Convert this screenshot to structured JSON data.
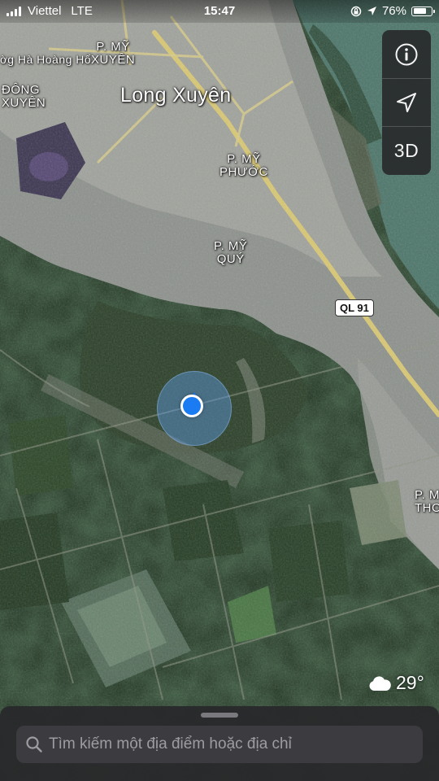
{
  "status_bar": {
    "carrier": "Viettel",
    "network": "LTE",
    "time": "15:47",
    "battery_percent": "76%",
    "battery_level": 0.76
  },
  "map": {
    "labels": {
      "ha_hoang_ho": "Hà Hoàng Hổ",
      "dong_xuyen_1": "ĐÔNG",
      "dong_xuyen_2": "XUYÊN",
      "my_xuyen_1": "P. MỸ",
      "my_xuyen_2": "XUYÊN",
      "city": "Long Xuyên",
      "my_phuoc_1": "P. MỸ",
      "my_phuoc_2": "PHƯỚC",
      "my_quy_1": "P. MỸ",
      "my_quy_2": "QUÝ",
      "my_tho_1": "P. MỸ",
      "my_tho_2": "THO",
      "route": "QL 91"
    },
    "colors": {
      "vegetation": "#1f3320",
      "urban": "#8d918c",
      "river": "#4c7569",
      "road": "#d9c873",
      "user_dot": "#1a7bf2"
    }
  },
  "controls": {
    "info_icon": "info-icon",
    "location_icon": "location-arrow-icon",
    "mode_label": "3D"
  },
  "weather": {
    "icon": "cloud-icon",
    "temperature": "29°"
  },
  "search": {
    "placeholder": "Tìm kiếm một địa điểm hoặc địa chỉ"
  }
}
